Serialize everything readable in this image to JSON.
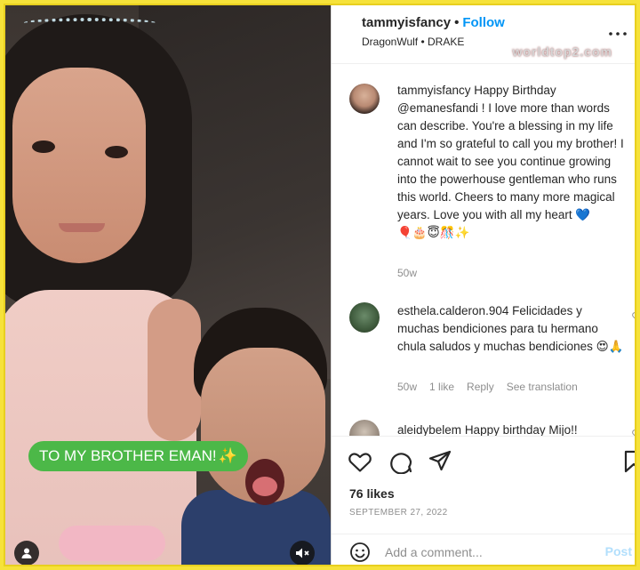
{
  "photo": {
    "sticker_text": "TO MY BROTHER EMAN!",
    "sticker_emoji": "✨"
  },
  "header": {
    "username": "tammyisfancy",
    "separator": "•",
    "follow_label": "Follow",
    "audio": "DragonWulf • DRAKE",
    "watermark": "worldtop2.com"
  },
  "caption": {
    "username": "tammyisfancy",
    "text": "Happy Birthday @emanesfandi ! I love more than words can describe. You're a blessing in my life and I'm so grateful to call you my brother! I cannot wait to see you continue growing into the powerhouse gentleman who runs this world. Cheers to many more magical years. Love you with all my heart 💙",
    "emojis": "🎈🎂😇🎊✨",
    "time": "50w"
  },
  "comments": [
    {
      "username": "esthela.calderon.904",
      "text": "Felicidades y muchas bendiciones para tu hermano chula saludos y muchas bendiciones 😍🙏",
      "time": "50w",
      "likes": "1 like",
      "reply": "Reply",
      "translate": "See translation"
    },
    {
      "username": "aleidybelem",
      "text": "Happy birthday Mijo!!"
    }
  ],
  "actions": {
    "likes": "76 likes",
    "date": "SEPTEMBER 27, 2022"
  },
  "add_comment": {
    "placeholder": "Add a comment...",
    "post_label": "Post"
  },
  "colors": {
    "accent": "#0095f6",
    "sticker": "#4cb848",
    "frame": "#f6e23a"
  }
}
